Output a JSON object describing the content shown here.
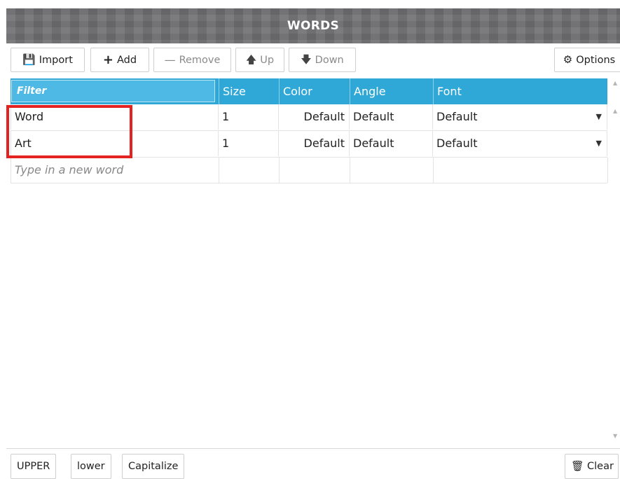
{
  "title": "WORDS",
  "toolbar": {
    "import": "Import",
    "add": "Add",
    "remove": "Remove",
    "up": "Up",
    "down": "Down",
    "options": "Options"
  },
  "table": {
    "filter_placeholder": "Filter",
    "columns": [
      "Size",
      "Color",
      "Angle",
      "Font"
    ],
    "rows": [
      {
        "word": "Word",
        "size": "1",
        "color": "Default",
        "angle": "Default",
        "font": "Default"
      },
      {
        "word": "Art",
        "size": "1",
        "color": "Default",
        "angle": "Default",
        "font": "Default"
      }
    ],
    "new_word_placeholder": "Type in a new word"
  },
  "bottom": {
    "upper": "UPPER",
    "lower": "lower",
    "capitalize": "Capitalize",
    "clear": "Clear"
  },
  "colors": {
    "header_bg": "#2fa8d8",
    "titlebar_bg": "#6f6f72",
    "highlight": "#e32222"
  },
  "icons": {
    "import": "import-icon",
    "add": "plus-icon",
    "remove": "minus-icon",
    "up": "arrow-up-icon",
    "down": "arrow-down-icon",
    "options": "gear-icon",
    "clear": "trash-icon",
    "dropdown": "caret-down-icon"
  }
}
